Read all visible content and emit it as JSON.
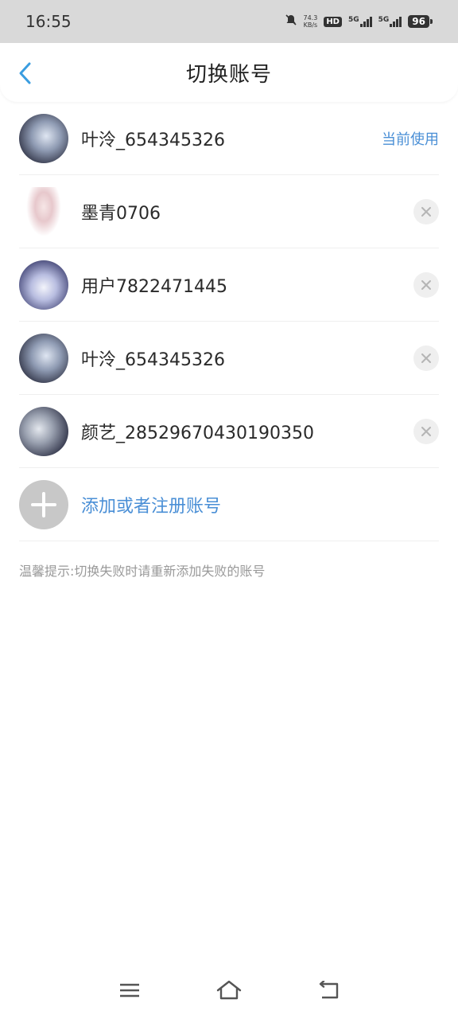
{
  "status_bar": {
    "time": "16:55",
    "net_speed_value": "74.3",
    "net_speed_unit": "KB/s",
    "hd_label": "HD",
    "net_1": "5G",
    "net_2": "5G",
    "battery": "96"
  },
  "header": {
    "title": "切换账号"
  },
  "accounts": [
    {
      "name": "叶泠_654345326",
      "status": "当前使用"
    },
    {
      "name": "墨青0706"
    },
    {
      "name": "用户7822471445"
    },
    {
      "name": "叶泠_654345326"
    },
    {
      "name": "颜艺_28529670430190350"
    }
  ],
  "add_account": {
    "label": "添加或者注册账号"
  },
  "tip": "温馨提示:切换失败时请重新添加失败的账号",
  "colors": {
    "accent": "#4a8fd6",
    "status_bar_bg": "#d9d9d9"
  },
  "icons": {
    "back": "chevron-left-icon",
    "remove": "close-icon",
    "add": "plus-icon",
    "menu": "menu-icon",
    "home": "home-icon",
    "back_nav": "back-arrow-icon"
  }
}
